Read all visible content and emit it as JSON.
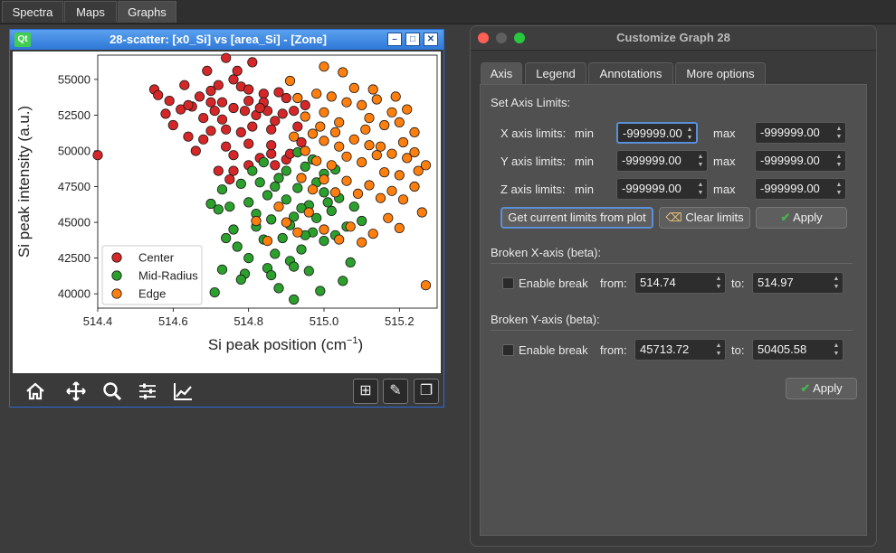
{
  "top_tabs": [
    "Spectra",
    "Maps",
    "Graphs"
  ],
  "graph_window": {
    "title": "28-scatter: [x0_Si] vs [area_Si] - [Zone]",
    "logo": "Qt",
    "buttons": [
      "minimize-icon",
      "maximize-icon",
      "close-icon"
    ],
    "toolbar_icons": [
      "home-icon",
      "move-icon",
      "zoom-icon",
      "sliders-icon",
      "trend-icon"
    ],
    "toolbar_right_icons": [
      "add-icon",
      "edit-icon",
      "copy-icon"
    ]
  },
  "chart_data": {
    "type": "scatter",
    "xlabel": "Si peak position (cm",
    "xlabel_sup": "−1",
    "xlabel_tail": ")",
    "ylabel": "Si peak intensity (a.u.)",
    "xlim": [
      514.4,
      515.3
    ],
    "ylim": [
      39000,
      56700
    ],
    "xticks": [
      514.4,
      514.6,
      514.8,
      515.0,
      515.2
    ],
    "xtick_labels": [
      "514.4",
      "514.6",
      "514.8",
      "515.0",
      "515.2"
    ],
    "yticks": [
      40000,
      42500,
      45000,
      47500,
      50000,
      52500,
      55000
    ],
    "ytick_labels": [
      "40000",
      "42500",
      "45000",
      "47500",
      "50000",
      "52500",
      "55000"
    ],
    "legend": {
      "position": "lower-left",
      "entries": [
        "Center",
        "Mid-Radius",
        "Edge"
      ]
    },
    "grid": false,
    "series": [
      {
        "name": "Center",
        "color": "#d62728",
        "points": [
          [
            514.4,
            49700
          ],
          [
            514.55,
            54300
          ],
          [
            514.56,
            53900
          ],
          [
            514.63,
            54600
          ],
          [
            514.7,
            54200
          ],
          [
            514.72,
            54600
          ],
          [
            514.74,
            56500
          ],
          [
            514.76,
            55000
          ],
          [
            514.78,
            54500
          ],
          [
            514.8,
            53500
          ],
          [
            514.84,
            54000
          ],
          [
            514.88,
            54100
          ],
          [
            514.62,
            52900
          ],
          [
            514.65,
            53100
          ],
          [
            514.68,
            52300
          ],
          [
            514.6,
            51800
          ],
          [
            514.64,
            51000
          ],
          [
            514.66,
            50000
          ],
          [
            514.7,
            51400
          ],
          [
            514.73,
            52200
          ],
          [
            514.76,
            53000
          ],
          [
            514.79,
            52800
          ],
          [
            514.82,
            52500
          ],
          [
            514.85,
            52800
          ],
          [
            514.86,
            51500
          ],
          [
            514.74,
            50300
          ],
          [
            514.76,
            49700
          ],
          [
            514.8,
            50500
          ],
          [
            514.83,
            49500
          ],
          [
            514.86,
            49800
          ],
          [
            514.72,
            48600
          ],
          [
            514.75,
            48000
          ],
          [
            514.9,
            49400
          ],
          [
            514.92,
            52800
          ],
          [
            514.93,
            51700
          ],
          [
            514.69,
            55600
          ],
          [
            514.7,
            53400
          ],
          [
            514.67,
            53800
          ],
          [
            514.73,
            53400
          ],
          [
            514.81,
            51700
          ],
          [
            514.86,
            50400
          ],
          [
            514.84,
            53400
          ],
          [
            514.78,
            51300
          ],
          [
            514.87,
            49000
          ],
          [
            514.94,
            50600
          ],
          [
            514.77,
            55600
          ],
          [
            514.58,
            52600
          ],
          [
            514.59,
            53500
          ],
          [
            514.74,
            51500
          ],
          [
            514.83,
            53000
          ],
          [
            514.9,
            53700
          ],
          [
            514.76,
            48600
          ],
          [
            514.8,
            49000
          ],
          [
            514.68,
            50800
          ],
          [
            514.64,
            53200
          ],
          [
            514.71,
            52800
          ],
          [
            514.8,
            54300
          ],
          [
            514.89,
            52600
          ],
          [
            514.95,
            53200
          ],
          [
            514.81,
            56200
          ],
          [
            514.87,
            52100
          ],
          [
            514.91,
            49800
          ]
        ]
      },
      {
        "name": "Mid-Radius",
        "color": "#2ca02c",
        "points": [
          [
            514.73,
            47300
          ],
          [
            514.75,
            46100
          ],
          [
            514.76,
            44500
          ],
          [
            514.78,
            47700
          ],
          [
            514.8,
            46400
          ],
          [
            514.82,
            45600
          ],
          [
            514.83,
            47800
          ],
          [
            514.85,
            46900
          ],
          [
            514.86,
            45200
          ],
          [
            514.88,
            48100
          ],
          [
            514.9,
            46600
          ],
          [
            514.92,
            45400
          ],
          [
            514.93,
            47400
          ],
          [
            514.95,
            48900
          ],
          [
            514.96,
            46200
          ],
          [
            514.98,
            45300
          ],
          [
            515.0,
            47100
          ],
          [
            515.02,
            45800
          ],
          [
            515.04,
            46700
          ],
          [
            515.06,
            44700
          ],
          [
            515.08,
            46100
          ],
          [
            515.1,
            45100
          ],
          [
            514.74,
            43900
          ],
          [
            514.77,
            43300
          ],
          [
            514.8,
            42500
          ],
          [
            514.84,
            43800
          ],
          [
            514.87,
            42800
          ],
          [
            514.89,
            43900
          ],
          [
            514.91,
            42300
          ],
          [
            514.94,
            43100
          ],
          [
            514.97,
            44300
          ],
          [
            515.0,
            43700
          ],
          [
            515.03,
            44100
          ],
          [
            514.73,
            41700
          ],
          [
            514.79,
            41400
          ],
          [
            514.85,
            41800
          ],
          [
            514.88,
            40400
          ],
          [
            514.92,
            39600
          ],
          [
            514.96,
            41600
          ],
          [
            514.99,
            40200
          ],
          [
            515.05,
            40900
          ],
          [
            515.07,
            42200
          ],
          [
            514.71,
            40100
          ],
          [
            514.78,
            41000
          ],
          [
            514.81,
            48600
          ],
          [
            514.84,
            49200
          ],
          [
            514.9,
            48600
          ],
          [
            514.93,
            49900
          ],
          [
            514.97,
            49400
          ],
          [
            515.0,
            48400
          ],
          [
            514.72,
            45900
          ],
          [
            514.7,
            46300
          ],
          [
            514.95,
            44100
          ],
          [
            514.98,
            47800
          ],
          [
            515.03,
            48700
          ],
          [
            514.94,
            46000
          ],
          [
            514.82,
            44700
          ],
          [
            514.87,
            47500
          ],
          [
            514.91,
            44800
          ],
          [
            515.01,
            46400
          ],
          [
            514.86,
            41300
          ],
          [
            514.92,
            41900
          ]
        ]
      },
      {
        "name": "Edge",
        "color": "#ff7f0e",
        "points": [
          [
            514.91,
            54900
          ],
          [
            514.93,
            53700
          ],
          [
            514.95,
            52400
          ],
          [
            514.97,
            51200
          ],
          [
            514.98,
            54000
          ],
          [
            515.0,
            52700
          ],
          [
            515.02,
            53800
          ],
          [
            515.04,
            52000
          ],
          [
            515.06,
            53400
          ],
          [
            515.08,
            54400
          ],
          [
            515.1,
            53200
          ],
          [
            515.12,
            52300
          ],
          [
            515.14,
            53600
          ],
          [
            515.16,
            51800
          ],
          [
            515.18,
            52700
          ],
          [
            515.2,
            52000
          ],
          [
            515.22,
            52900
          ],
          [
            515.24,
            51300
          ],
          [
            514.92,
            51000
          ],
          [
            514.95,
            50000
          ],
          [
            514.98,
            49300
          ],
          [
            515.0,
            50700
          ],
          [
            515.02,
            49000
          ],
          [
            515.04,
            50300
          ],
          [
            515.06,
            49600
          ],
          [
            515.08,
            50800
          ],
          [
            515.1,
            49200
          ],
          [
            515.12,
            50400
          ],
          [
            515.14,
            49700
          ],
          [
            515.16,
            48500
          ],
          [
            515.18,
            49800
          ],
          [
            515.2,
            48300
          ],
          [
            515.22,
            49500
          ],
          [
            515.25,
            48600
          ],
          [
            515.27,
            49000
          ],
          [
            514.94,
            48100
          ],
          [
            514.97,
            47300
          ],
          [
            515.0,
            48000
          ],
          [
            515.03,
            47100
          ],
          [
            515.06,
            47900
          ],
          [
            515.09,
            47000
          ],
          [
            515.12,
            47600
          ],
          [
            515.15,
            46700
          ],
          [
            515.18,
            47200
          ],
          [
            515.21,
            46600
          ],
          [
            515.24,
            47500
          ],
          [
            514.88,
            46100
          ],
          [
            514.9,
            45000
          ],
          [
            514.93,
            44300
          ],
          [
            514.96,
            45700
          ],
          [
            515.0,
            44500
          ],
          [
            515.04,
            43800
          ],
          [
            515.07,
            44700
          ],
          [
            515.1,
            43600
          ],
          [
            515.13,
            44200
          ],
          [
            515.17,
            45300
          ],
          [
            515.2,
            44600
          ],
          [
            515.26,
            45700
          ],
          [
            514.82,
            45100
          ],
          [
            514.85,
            43700
          ],
          [
            515.0,
            55900
          ],
          [
            515.05,
            55500
          ],
          [
            515.13,
            54300
          ],
          [
            515.19,
            53800
          ],
          [
            515.27,
            40600
          ],
          [
            514.99,
            51700
          ],
          [
            515.03,
            51300
          ],
          [
            515.11,
            51500
          ],
          [
            515.15,
            50300
          ],
          [
            515.21,
            50600
          ],
          [
            515.24,
            49900
          ]
        ]
      }
    ]
  },
  "customize": {
    "title": "Customize Graph 28",
    "tabs": [
      "Axis",
      "Legend",
      "Annotations",
      "More options"
    ],
    "set_axis_limits": "Set Axis Limits:",
    "x_label": "X axis limits:",
    "y_label": "Y axis limits:",
    "z_label": "Z axis limits:",
    "min_label": "min",
    "max_label": "max",
    "x_min": "-999999.00",
    "x_max": "-999999.00",
    "y_min": "-999999.00",
    "y_max": "-999999.00",
    "z_min": "-999999.00",
    "z_max": "-999999.00",
    "get_limits_button": "Get current limits from plot",
    "clear_limits_button": "Clear limits",
    "apply_button": "Apply",
    "broken_x_title": "Broken X-axis (beta):",
    "broken_y_title": "Broken Y-axis (beta):",
    "enable_break": "Enable break",
    "from_label": "from:",
    "to_label": "to:",
    "bx_from": "514.74",
    "bx_to": "514.97",
    "by_from": "45713.72",
    "by_to": "50405.58",
    "apply_bottom": "Apply"
  },
  "colors": {
    "title_bar": "#2e78d8",
    "focus": "#5b8fd6",
    "check": "#4caf50"
  }
}
